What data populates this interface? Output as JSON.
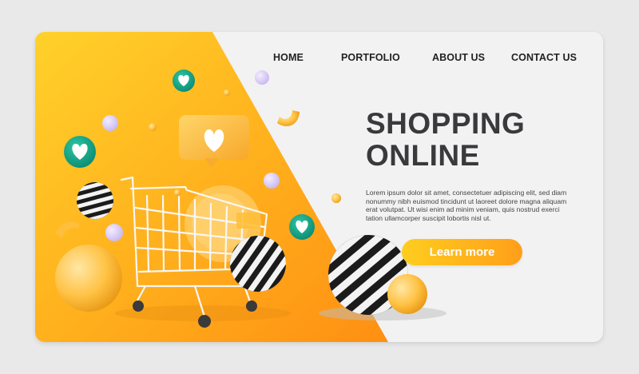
{
  "nav": {
    "items": [
      {
        "label": "HOME"
      },
      {
        "label": "PORTFOLIO"
      },
      {
        "label": "ABOUT US"
      },
      {
        "label": "CONTACT US"
      }
    ]
  },
  "hero": {
    "title_line1": "SHOPPING",
    "title_line2": "ONLINE",
    "body": "Lorem ipsum dolor sit amet, consectetuer adipiscing elit, sed diam nonummy nibh euismod tincidunt ut laoreet dolore magna aliquam erat volutpat. Ut wisi enim ad minim veniam, quis nostrud exerci tation ullamcorper suscipit lobortis nisl ut.",
    "cta_label": "Learn more"
  },
  "colors": {
    "accent_yellow": "#ffcd1e",
    "accent_orange": "#ff9f1a",
    "panel_light": "#f2f2f3",
    "heart_badge": "#16a58a"
  },
  "icons": [
    "heart-icon",
    "shopping-cart-icon",
    "chat-bubble-heart-icon"
  ]
}
